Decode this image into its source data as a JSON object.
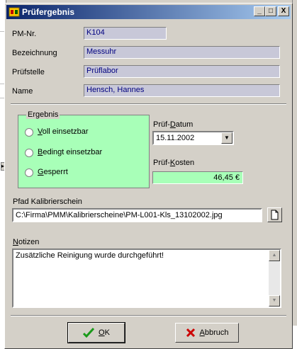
{
  "window": {
    "title": "Prüfergebnis",
    "minimize": "_",
    "maximize": "□",
    "close": "X"
  },
  "fields": {
    "pm_nr": {
      "label": "PM-Nr.",
      "value": "K104"
    },
    "bezeichnung": {
      "label": "Bezeichnung",
      "value": "Messuhr"
    },
    "pruefstelle": {
      "label": "Prüfstelle",
      "value": "Prüflabor"
    },
    "name": {
      "label": "Name",
      "value": "Hensch, Hannes"
    }
  },
  "ergebnis": {
    "label": "Ergebnis",
    "options": [
      {
        "mn": "V",
        "rest": "oll einsetzbar",
        "selected": false
      },
      {
        "mn": "B",
        "rest": "edingt einsetzbar",
        "selected": false
      },
      {
        "mn": "G",
        "rest": "esperrt",
        "selected": false
      }
    ]
  },
  "pruef_datum": {
    "pre": "Prüf-",
    "mn": "D",
    "rest": "atum",
    "value": "15.11.2002"
  },
  "pruef_kosten": {
    "pre": "Prüf-",
    "mn": "K",
    "rest": "osten",
    "value": "46,45 €"
  },
  "pfad": {
    "label": "Pfad Kalibrierschein",
    "value": "C:\\Firma\\PMM\\Kalibrierscheine\\PM-L001-Kls_13102002.jpg"
  },
  "notizen": {
    "mn": "N",
    "rest": "otizen",
    "value": "Zusätzliche Reinigung wurde durchgeführt!"
  },
  "buttons": {
    "ok": {
      "mn": "O",
      "rest": "K"
    },
    "abbruch": {
      "mn": "A",
      "rest": "bbruch"
    }
  },
  "colors": {
    "accent_green": "#a8ffb8",
    "readonly_bg": "#c8c8d8",
    "readonly_text": "#000080",
    "title_start": "#0a246a",
    "title_end": "#a6caf0"
  },
  "icons": [
    "app-icon",
    "minimize-icon",
    "maximize-icon",
    "close-icon",
    "dropdown-arrow-icon",
    "file-open-icon",
    "checkmark-icon",
    "x-cancel-icon",
    "scroll-up-icon",
    "scroll-down-icon"
  ]
}
